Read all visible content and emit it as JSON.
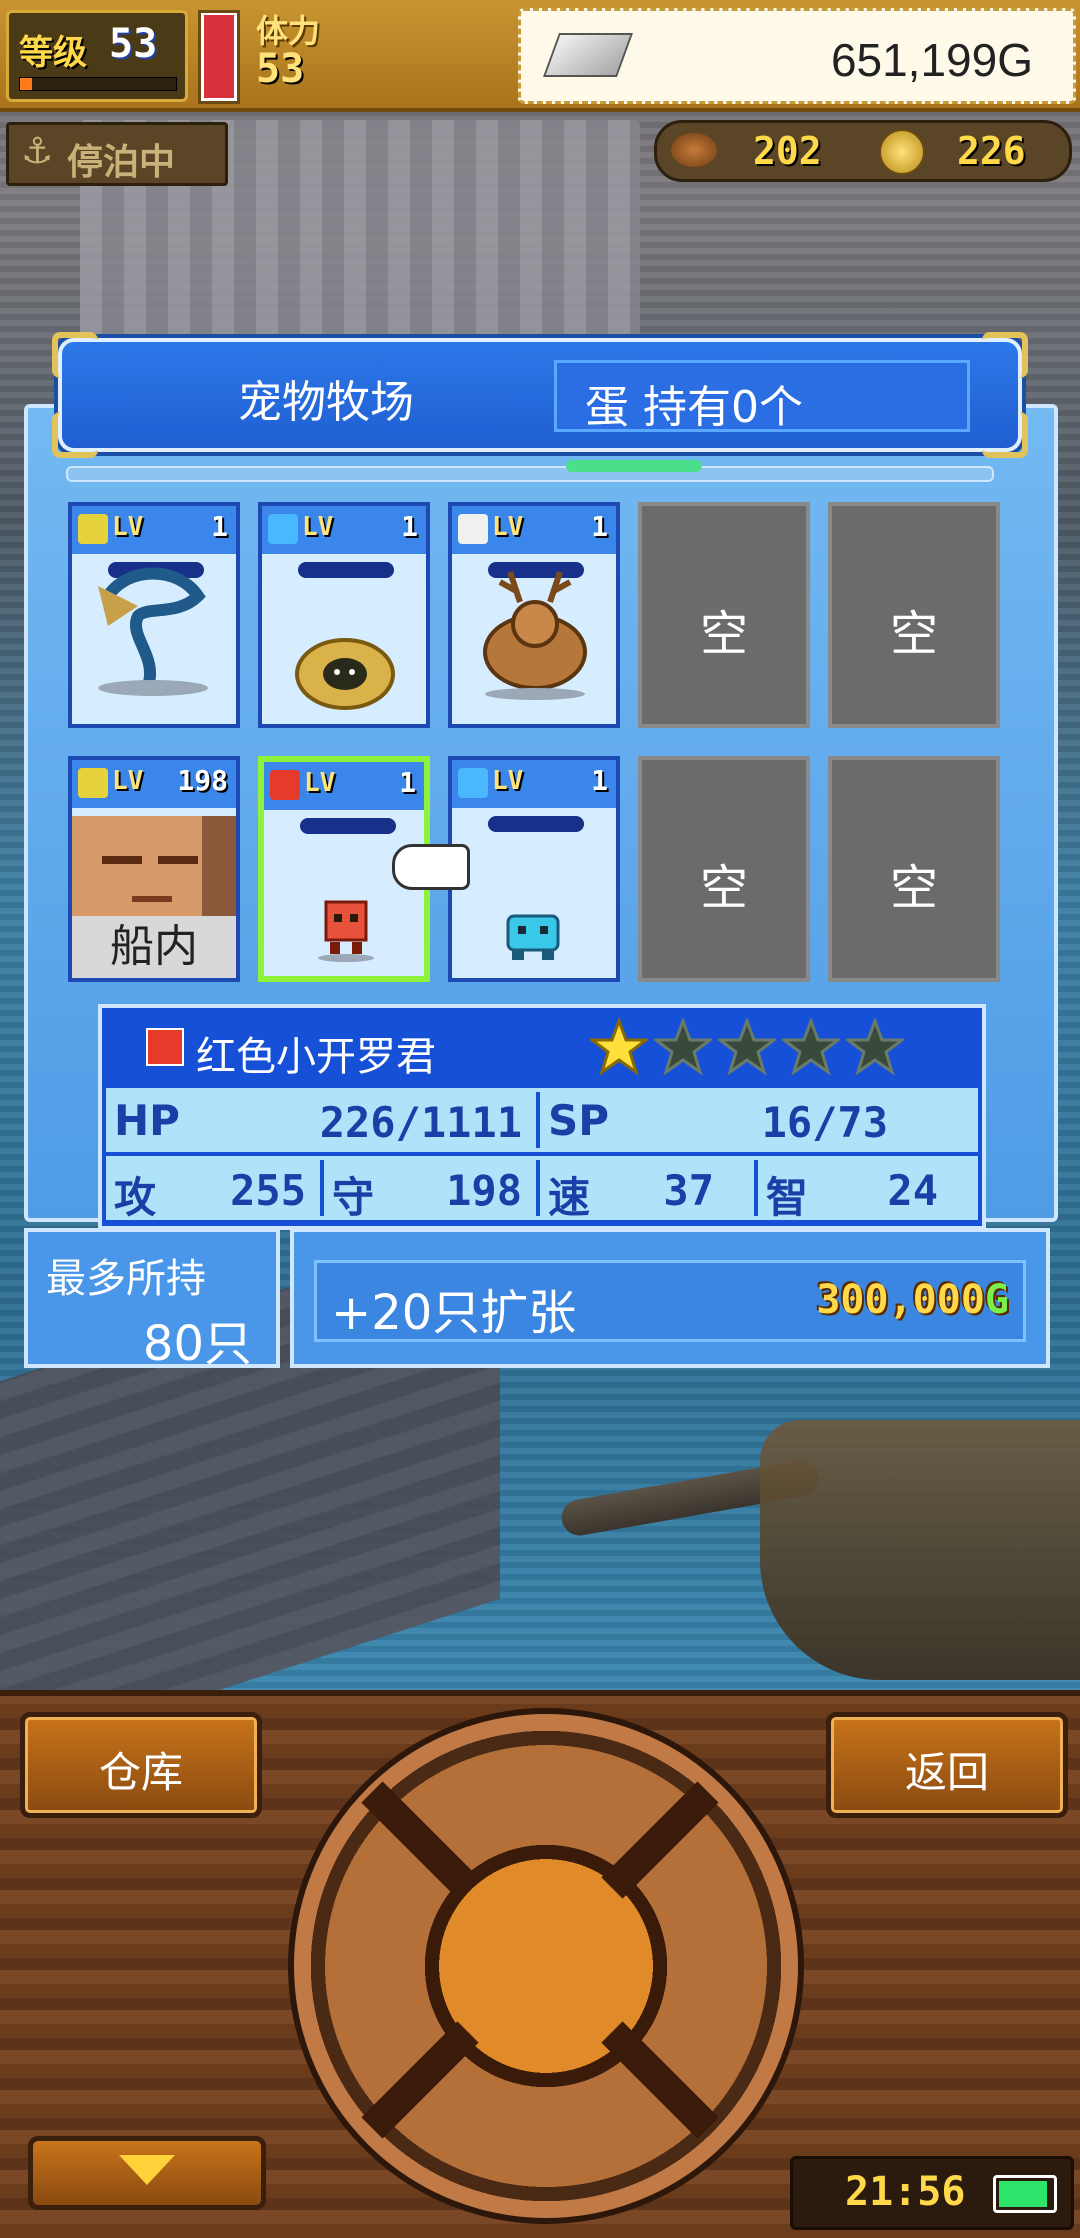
{
  "hud": {
    "level_label": "等级",
    "level": "53",
    "level_progress": 0.08,
    "stamina_label": "体力",
    "stamina": "53",
    "stamina_fill": 0.94,
    "gold": "651,199G",
    "status": "停泊中",
    "resource1": "202",
    "resource2": "226"
  },
  "panel": {
    "title": "宠物牧场",
    "egg_text": "蛋 持有0个"
  },
  "pets": [
    {
      "element": "lightning",
      "element_color": "#e6d23a",
      "lv_label": "LV",
      "level": "1",
      "sprite": "winged-serpent"
    },
    {
      "element": "water",
      "element_color": "#4ab8ff",
      "lv_label": "LV",
      "level": "1",
      "sprite": "shell-creature"
    },
    {
      "element": "neutral",
      "element_color": "#f0f0f0",
      "lv_label": "LV",
      "level": "1",
      "sprite": "antlered-beast"
    },
    {
      "empty_label": "空"
    },
    {
      "empty_label": "空"
    },
    {
      "element": "lightning",
      "element_color": "#e6d23a",
      "lv_label": "LV",
      "level": "198",
      "sprite": "bald-man",
      "tag": "船内"
    },
    {
      "element": "fire",
      "element_color": "#e63a2a",
      "lv_label": "LV",
      "level": "1",
      "sprite": "red-robot",
      "selected": true
    },
    {
      "element": "water",
      "element_color": "#4ab8ff",
      "lv_label": "LV",
      "level": "1",
      "sprite": "blue-robot"
    },
    {
      "empty_label": "空"
    },
    {
      "empty_label": "空"
    }
  ],
  "selected_pet": {
    "name": "红色小开罗君",
    "stars_filled": 1,
    "stars_total": 5,
    "hp_label": "HP",
    "hp": "226/1111",
    "sp_label": "SP",
    "sp": "16/73",
    "atk_label": "攻",
    "atk": "255",
    "def_label": "守",
    "def": "198",
    "spd_label": "速",
    "spd": "37",
    "int_label": "智",
    "int": "24"
  },
  "capacity": {
    "label": "最多所持",
    "value": "80只"
  },
  "expand": {
    "label": "+20只扩张",
    "cost": "300,000",
    "cost_unit": "G"
  },
  "console": {
    "warehouse": "仓库",
    "back": "返回",
    "clock": "21:56",
    "battery_level": 0.82
  },
  "colors": {
    "panel_blue": "#4f9be6",
    "title_blue": "#1f5fd2",
    "select_green": "#8ef23a",
    "gold_text": "#ffd94a"
  }
}
